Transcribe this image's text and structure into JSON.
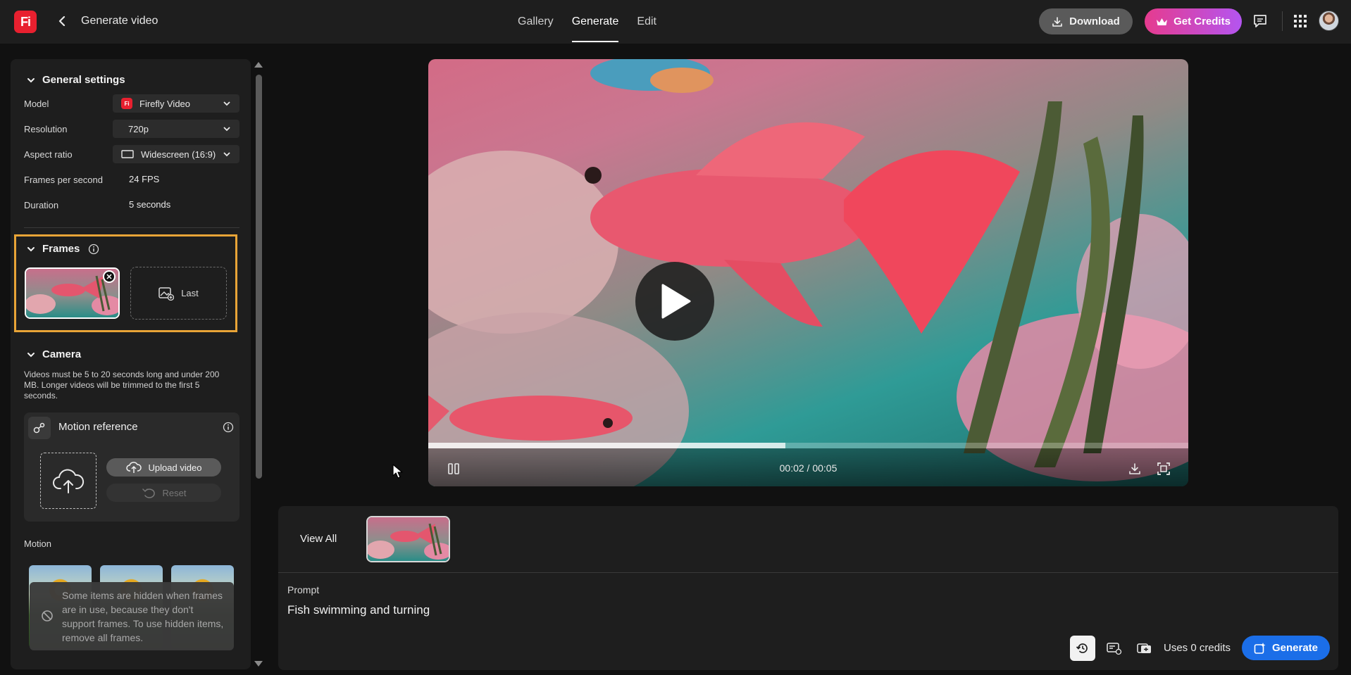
{
  "app": {
    "logo": "Fi",
    "title": "Generate video"
  },
  "nav": {
    "tabs": [
      "Gallery",
      "Generate",
      "Edit"
    ],
    "active": "Generate"
  },
  "header": {
    "download_label": "Download",
    "credits_label": "Get Credits"
  },
  "general": {
    "heading": "General settings",
    "rows": [
      {
        "label": "Model",
        "value": "Firefly Video"
      },
      {
        "label": "Resolution",
        "value": "720p"
      },
      {
        "label": "Aspect ratio",
        "value": "Widescreen (16:9)"
      },
      {
        "label": "Frames per second",
        "value": "24 FPS"
      },
      {
        "label": "Duration",
        "value": "5 seconds"
      }
    ]
  },
  "frames": {
    "heading": "Frames",
    "last_label": "Last"
  },
  "camera": {
    "heading": "Camera",
    "description": "Videos must be 5 to 20 seconds long and under 200 MB. Longer videos will be trimmed to the first 5 seconds.",
    "motion_reference": "Motion reference",
    "upload_label": "Upload video",
    "reset_label": "Reset"
  },
  "motion": {
    "label": "Motion",
    "tooltip": "Some items are hidden when frames are in use, because they don't support frames. To use hidden items, remove all frames."
  },
  "video": {
    "timecode": "00:02 / 00:05",
    "progress": 0.47
  },
  "history": {
    "view_all": "View All"
  },
  "prompt": {
    "label": "Prompt",
    "text": "Fish swimming and turning"
  },
  "footer": {
    "uses_credits": "Uses 0 credits",
    "generate_label": "Generate"
  },
  "colors": {
    "accent": "#1b6ee8",
    "frames_highlight": "#e8a437",
    "brand": "#e8202f"
  }
}
